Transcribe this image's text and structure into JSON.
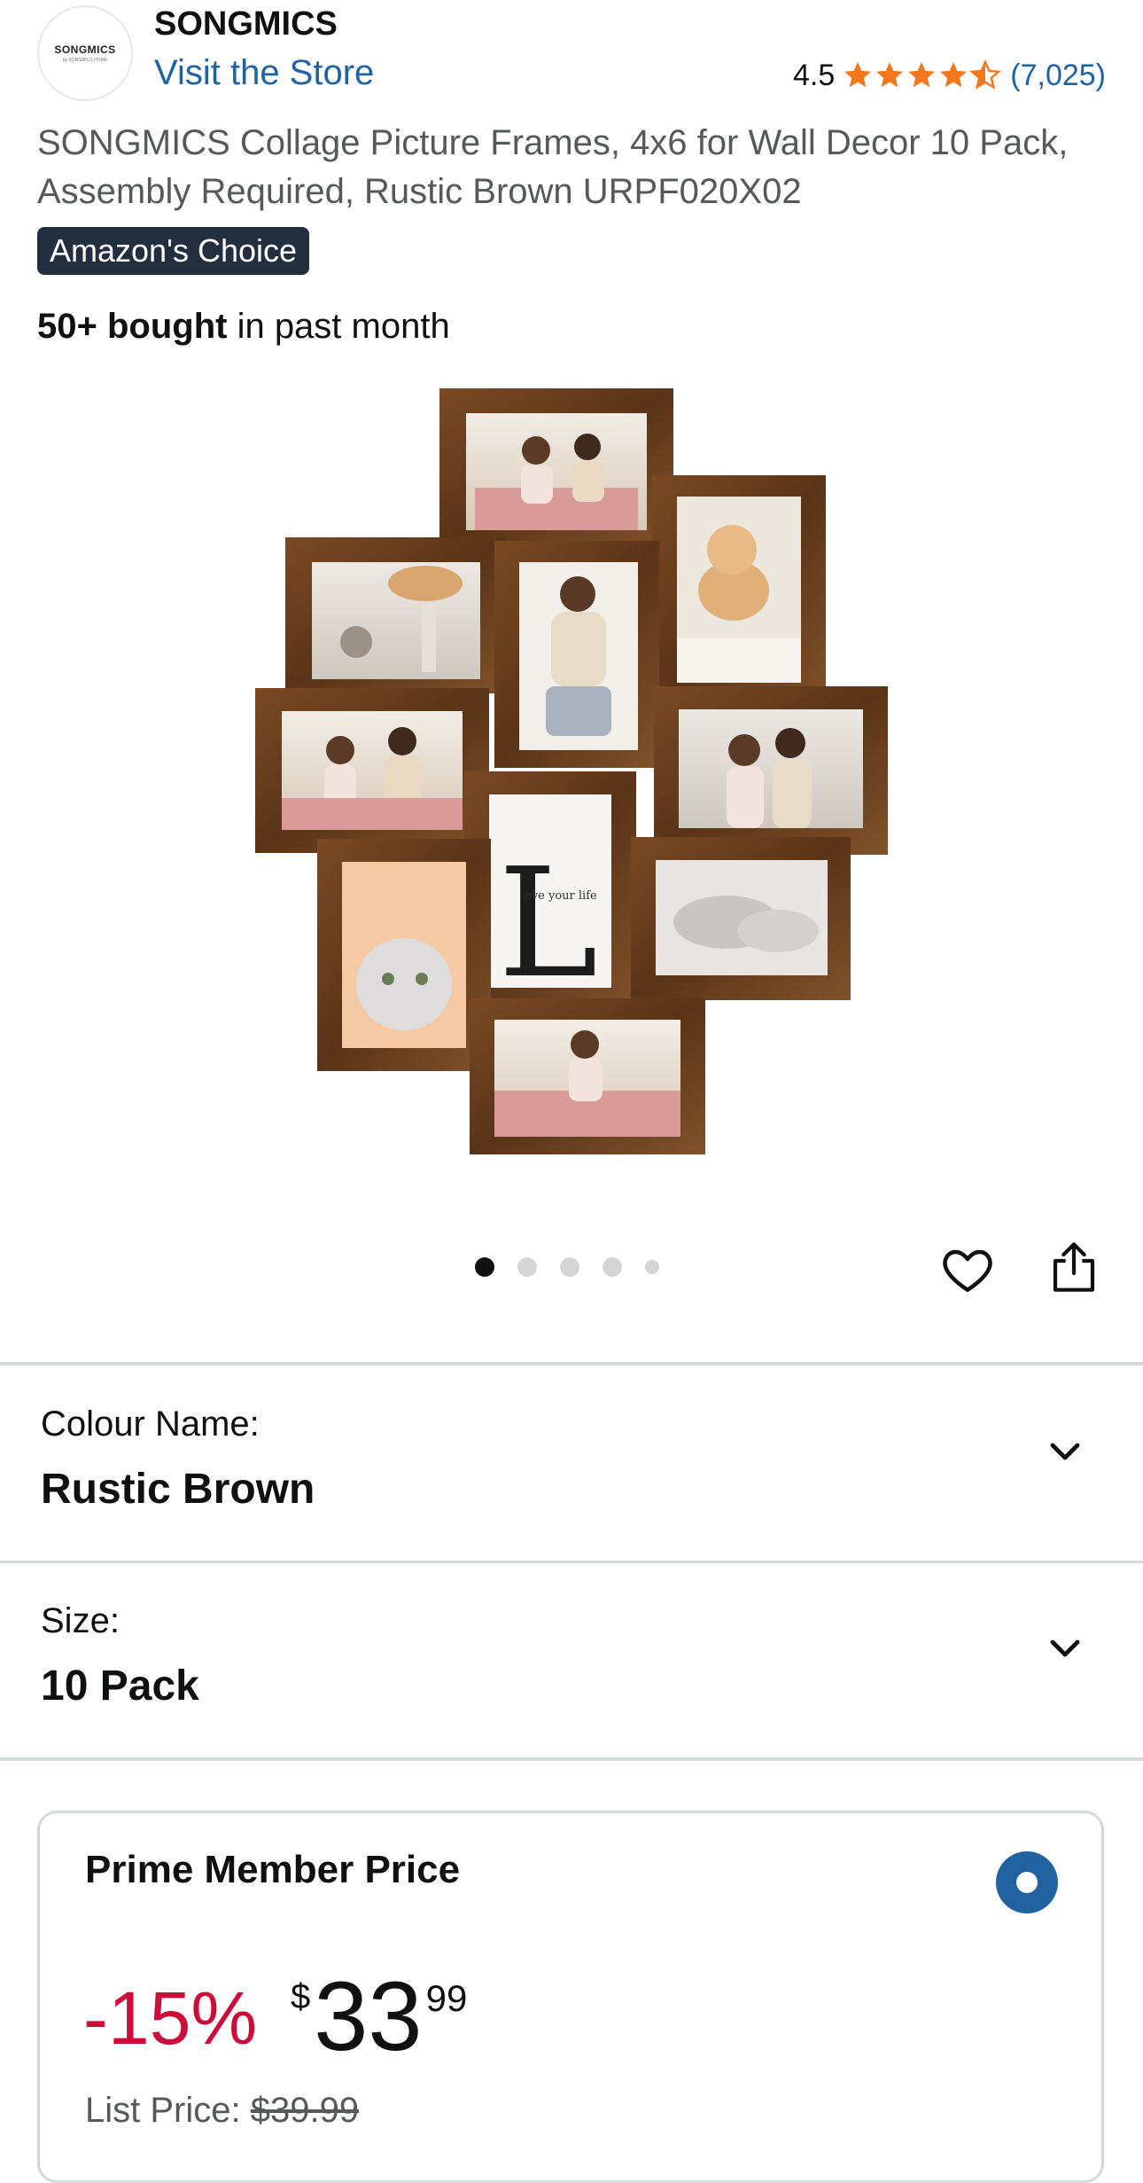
{
  "store": {
    "logo_text": "SONGMICS",
    "logo_sub": "by SONGMICS HOME",
    "brand": "SONGMICS",
    "visit_label": "Visit the Store"
  },
  "rating": {
    "value": "4.5",
    "stars": 4.5,
    "count": "(7,025)",
    "star_color": "#f3771d"
  },
  "product": {
    "title": "SONGMICS Collage Picture Frames, 4x6 for Wall Decor 10 Pack, Assembly Required, Rustic Brown URPF020X02",
    "badge": "Amazon's Choice",
    "bought_bold": "50+ bought",
    "bought_rest": " in past month",
    "image_caption_text": "ove your life",
    "image_letter": "L"
  },
  "carousel": {
    "total": 5,
    "active": 0
  },
  "options": {
    "colour_label": "Colour Name:",
    "colour_value": "Rustic Brown",
    "size_label": "Size:",
    "size_value": "10 Pack"
  },
  "price_card": {
    "title": "Prime Member Price",
    "discount": "-15%",
    "currency": "$",
    "whole": "33",
    "fraction": "99",
    "list_label": "List Price: ",
    "list_price": "$39.99"
  },
  "colors": {
    "link": "#2162a1",
    "discount": "#cc0c39",
    "badge_bg": "#232f3e",
    "frame_wood": "#6b3f1e"
  }
}
